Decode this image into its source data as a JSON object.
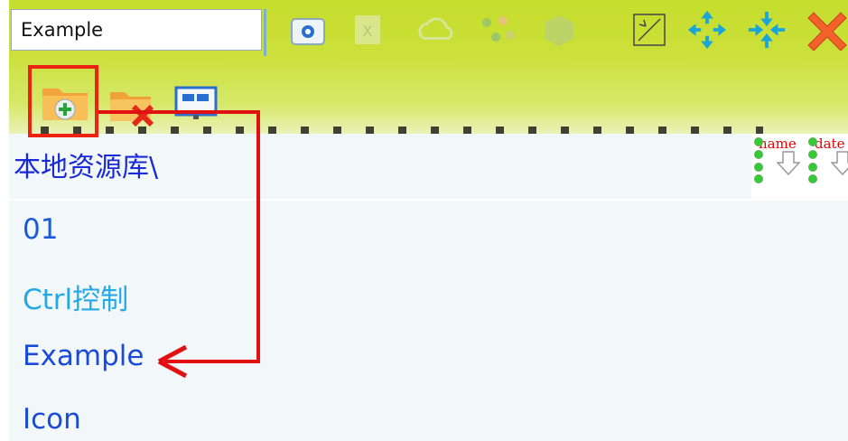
{
  "toolbar": {
    "title_value": "Example",
    "icons": [
      "settings-folder-icon",
      "excel-icon",
      "cloud-icon",
      "tree-icon",
      "box-icon",
      "shrink-icon",
      "expand-arrows-icon",
      "collapse-arrows-icon",
      "close-icon"
    ],
    "sub_icons": [
      "add-folder-icon",
      "delete-folder-icon",
      "screen-icon"
    ]
  },
  "path": {
    "text": "本地资源库\\"
  },
  "tree": {
    "items": [
      {
        "label": "01",
        "color": "#1a5ad8"
      },
      {
        "label": "Ctrl控制",
        "color": "#25a8e8"
      },
      {
        "label": "Example",
        "color": "#1a4ad8"
      },
      {
        "label": "Icon",
        "color": "#1a4ad8"
      }
    ]
  },
  "views": {
    "name_label": "name",
    "date_label": "date"
  },
  "colors": {
    "toolbar": "#c5dd2c",
    "annotation": "#e21111",
    "panel": "#f2f8f9"
  }
}
